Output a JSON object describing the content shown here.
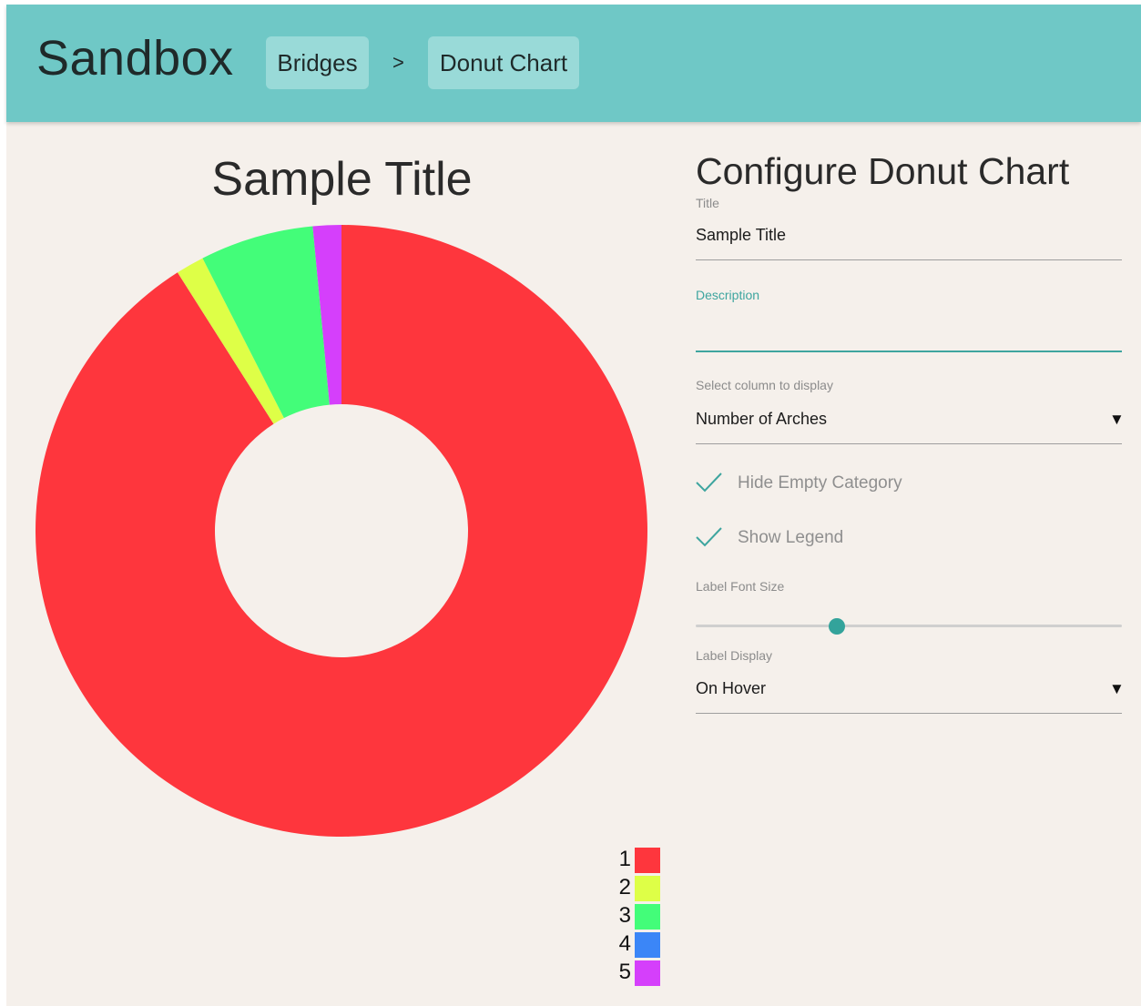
{
  "header": {
    "app_title": "Sandbox",
    "breadcrumbs": [
      "Bridges",
      "Donut Chart"
    ],
    "separator": ">"
  },
  "chart_data": {
    "type": "pie",
    "donut": true,
    "title": "Sample Title",
    "categories": [
      "1",
      "2",
      "3",
      "4",
      "5"
    ],
    "values": [
      91.0,
      1.5,
      6.0,
      0.0,
      1.5
    ],
    "colors": [
      "#fe363d",
      "#deff47",
      "#43fd79",
      "#3b86f7",
      "#d53ffb"
    ],
    "legend": "bottom-right",
    "start_angle_deg": 0,
    "direction": "clockwise-from-top"
  },
  "panel": {
    "title": "Configure Donut Chart",
    "title_field": {
      "label": "Title",
      "value": "Sample Title"
    },
    "description_field": {
      "label": "Description",
      "value": ""
    },
    "column_select": {
      "label": "Select column to display",
      "value": "Number of Arches"
    },
    "hide_empty": {
      "label": "Hide Empty Category",
      "checked": true
    },
    "show_legend": {
      "label": "Show Legend",
      "checked": true
    },
    "font_size": {
      "label": "Label Font Size",
      "value_fraction": 0.33
    },
    "label_display": {
      "label": "Label Display",
      "value": "On Hover"
    }
  },
  "theme": {
    "header_bg": "#6fc8c6",
    "accent": "#3ea59f",
    "page_bg": "#f5f0eb"
  }
}
